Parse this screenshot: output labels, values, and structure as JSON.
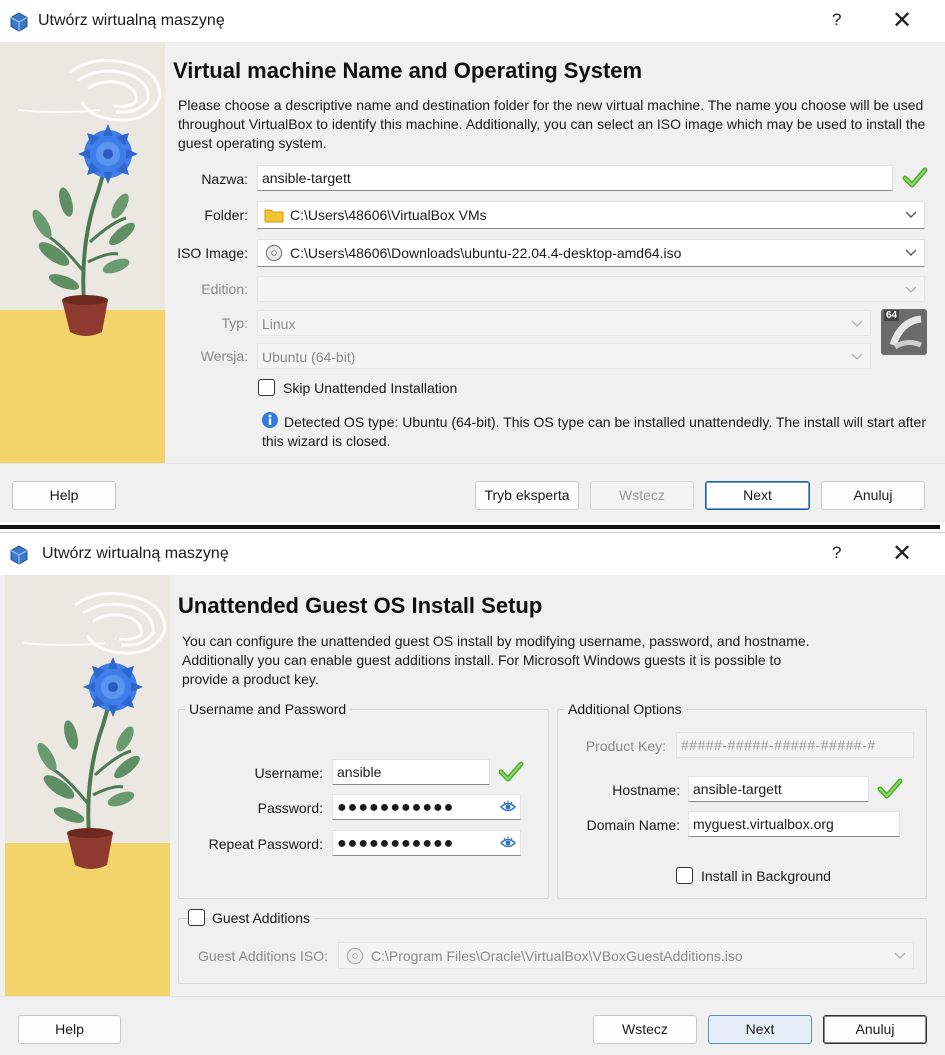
{
  "colors": {
    "accent": "#1e5aa8",
    "ok_green": "#4cae2f",
    "folder_yellow": "#f3c431",
    "flower_blue": "#3f7ee8",
    "sand": "#f2d46b"
  },
  "dialog1": {
    "window_title": "Utwórz wirtualną maszynę",
    "help_glyph": "?",
    "close_glyph": "✕",
    "page_title": "Virtual machine Name and Operating System",
    "description": "Please choose a descriptive name and destination folder for the new virtual machine. The name you choose will be used throughout VirtualBox to identify this machine. Additionally, you can select an ISO image which may be used to install the guest operating system.",
    "name_label": "Nazwa:",
    "name_value": "ansible-targett",
    "folder_label": "Folder:",
    "folder_value": "C:\\Users\\48606\\VirtualBox VMs",
    "iso_label": "ISO Image:",
    "iso_value": "C:\\Users\\48606\\Downloads\\ubuntu-22.04.4-desktop-amd64.iso",
    "edition_label": "Edition:",
    "edition_value": "",
    "type_label": "Typ:",
    "type_value": "Linux",
    "version_label": "Wersja:",
    "version_value": "Ubuntu (64-bit)",
    "os_badge": "64",
    "skip_label": "Skip Unattended Installation",
    "skip_checked": false,
    "info_text": "Detected OS type: Ubuntu (64-bit). This OS type can be installed unattendedly. The install will start after this wizard is closed.",
    "buttons": {
      "help": "Help",
      "expert": "Tryb eksperta",
      "back": "Wstecz",
      "next": "Next",
      "cancel": "Anuluj"
    }
  },
  "dialog2": {
    "window_title": "Utwórz wirtualną maszynę",
    "help_glyph": "?",
    "close_glyph": "✕",
    "page_title": "Unattended Guest OS Install Setup",
    "description": "You can configure the unattended guest OS install by modifying username, password, and hostname. Additionally you can enable guest additions install. For Microsoft Windows guests it is possible to provide a product key.",
    "user_group_title": "Username and Password",
    "username_label": "Username:",
    "username_value": "ansible",
    "password_label": "Password:",
    "password_value": "●●●●●●●●●●●",
    "repeat_label": "Repeat Password:",
    "repeat_value": "●●●●●●●●●●●",
    "options_group_title": "Additional Options",
    "product_key_label": "Product Key:",
    "product_key_placeholder": "#####-#####-#####-#####-#",
    "hostname_label": "Hostname:",
    "hostname_value": "ansible-targett",
    "domain_label": "Domain Name:",
    "domain_value": "myguest.virtualbox.org",
    "install_bg_label": "Install in Background",
    "install_bg_checked": false,
    "guest_additions_label": "Guest Additions",
    "guest_additions_checked": false,
    "ga_iso_label": "Guest Additions ISO:",
    "ga_iso_value": "C:\\Program Files\\Oracle\\VirtualBox\\VBoxGuestAdditions.iso",
    "buttons": {
      "help": "Help",
      "back": "Wstecz",
      "next": "Next",
      "cancel": "Anuluj"
    }
  }
}
